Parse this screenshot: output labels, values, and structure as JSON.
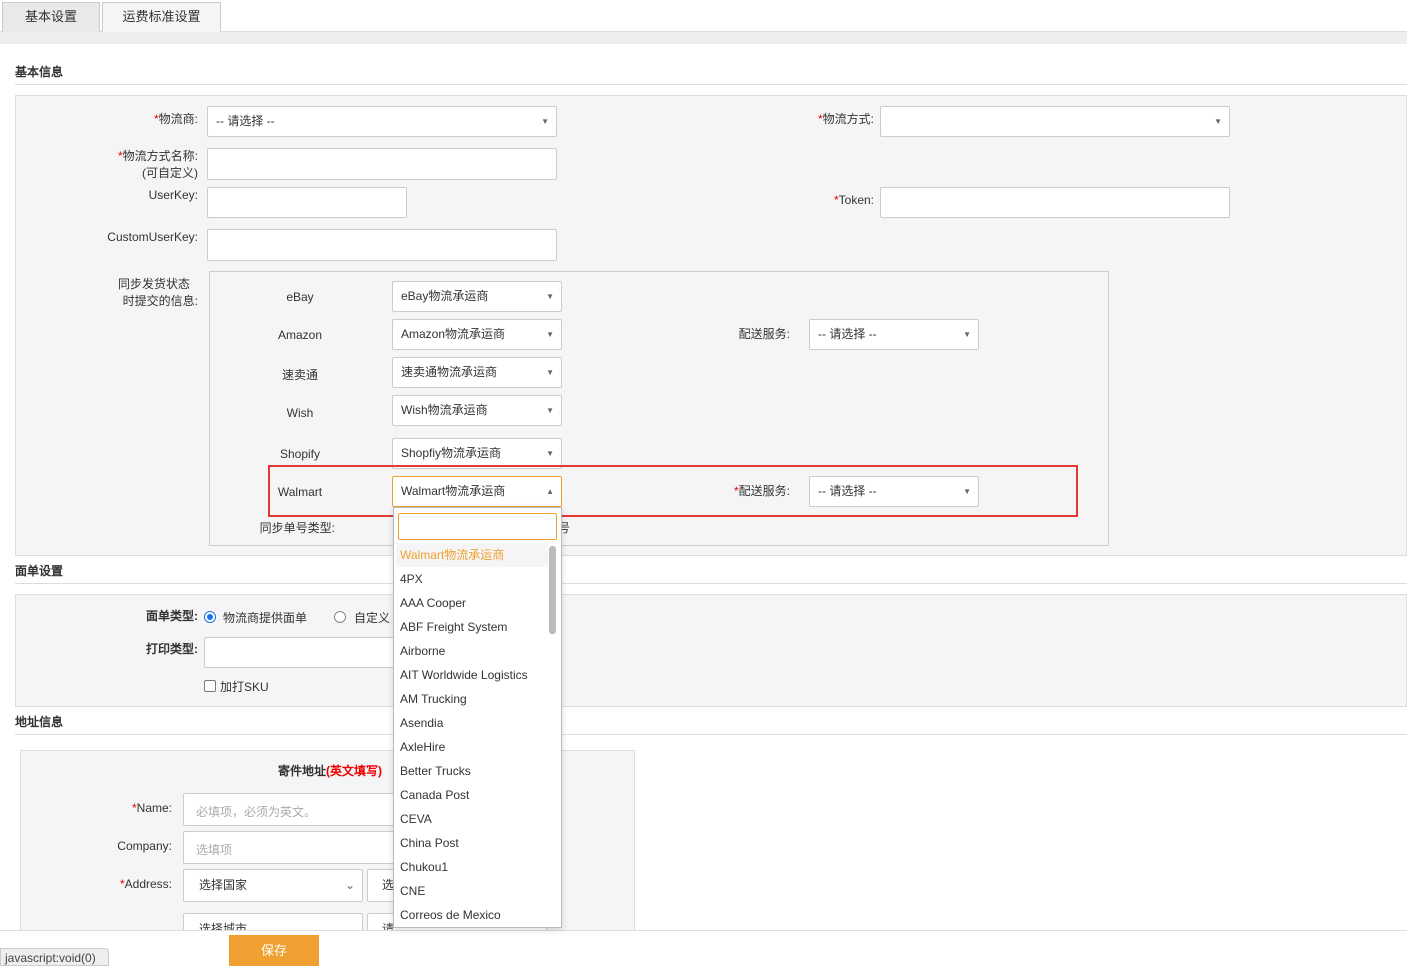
{
  "tabs": [
    {
      "label": "基本设置",
      "active": true
    },
    {
      "label": "运费标准设置",
      "active": false
    }
  ],
  "sections": {
    "basic_info": "基本信息",
    "waybill": "面单设置",
    "address": "地址信息"
  },
  "basic": {
    "carrier_label": "物流商:",
    "carrier_value": "-- 请选择 --",
    "method_label": "物流方式:",
    "method_value": "",
    "method_name_label": "物流方式名称:",
    "method_name_note": "(可自定义)",
    "method_name_value": "",
    "userkey_label": "UserKey:",
    "token_label": "Token:",
    "customuserkey_label": "CustomUserKey:",
    "sync_label_line1": "同步发货状态",
    "sync_label_line2": "时提交的信息:"
  },
  "platforms": [
    {
      "name": "eBay",
      "carrier": "eBay物流承运商"
    },
    {
      "name": "Amazon",
      "carrier": "Amazon物流承运商"
    },
    {
      "name": "速卖通",
      "carrier": "速卖通物流承运商"
    },
    {
      "name": "Wish",
      "carrier": "Wish物流承运商"
    },
    {
      "name": "Shopify",
      "carrier": "Shopfiy物流承运商"
    },
    {
      "name": "Walmart",
      "carrier": "Walmart物流承运商"
    }
  ],
  "amazon_service": {
    "label": "配送服务:",
    "value": "-- 请选择 --"
  },
  "walmart_service": {
    "label": "配送服务:",
    "value": "-- 请选择 --"
  },
  "sync_number_type_label": "同步单号类型:",
  "sync_number_tail": "号",
  "dropdown": {
    "search_value": "",
    "items": [
      "Walmart物流承运商",
      "4PX",
      "AAA Cooper",
      "ABF Freight System",
      "Airborne",
      "AIT Worldwide Logistics",
      "AM Trucking",
      "Asendia",
      "AxleHire",
      "Better Trucks",
      "Canada Post",
      "CEVA",
      "China Post",
      "Chukou1",
      "CNE",
      "Correos de Mexico"
    ],
    "selected_index": 0
  },
  "waybill": {
    "type_label": "面单类型:",
    "option_carrier": "物流商提供面单",
    "option_custom": "自定义",
    "print_label": "打印类型:",
    "add_sku": "加打SKU"
  },
  "address": {
    "sender_title": "寄件地址",
    "sender_note": "(英文填写)",
    "name_label": "Name:",
    "name_placeholder": "必填项，必须为英文。",
    "company_label": "Company:",
    "company_placeholder": "选填项",
    "address_label": "Address:",
    "country_value": "选择国家",
    "province_partial": "选",
    "city_partial": "选择城市",
    "district_partial": "请"
  },
  "save_label": "保存",
  "status_url": "javascript:void(0)",
  "colors": {
    "accent": "#f0a030",
    "required": "#e00000",
    "highlight_box": "#e53935"
  }
}
